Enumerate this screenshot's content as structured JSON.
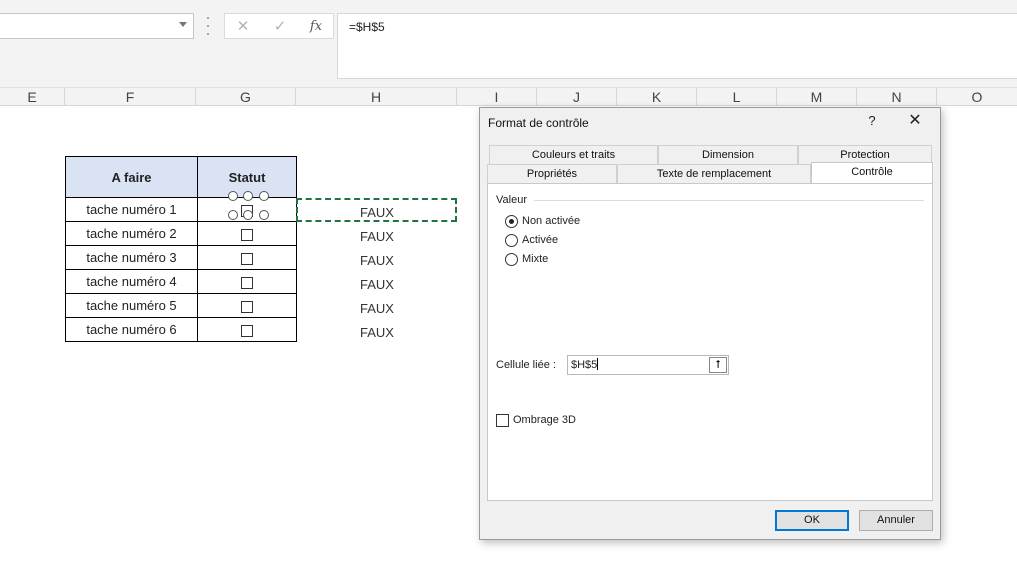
{
  "formula_bar": {
    "cancel_icon": "✕",
    "enter_icon": "✓",
    "fx_label": "fx",
    "formula": "=$H$5"
  },
  "columns": [
    "E",
    "F",
    "G",
    "H",
    "I",
    "J",
    "K",
    "L",
    "M",
    "N",
    "O"
  ],
  "task_table": {
    "headers": [
      "A faire",
      "Statut"
    ],
    "rows": [
      {
        "task": "tache numéro 1",
        "checked": false
      },
      {
        "task": "tache numéro 2",
        "checked": false
      },
      {
        "task": "tache numéro 3",
        "checked": false
      },
      {
        "task": "tache numéro 4",
        "checked": false
      },
      {
        "task": "tache numéro 5",
        "checked": false
      },
      {
        "task": "tache numéro 6",
        "checked": false
      }
    ]
  },
  "h_column_values": [
    "FAUX",
    "FAUX",
    "FAUX",
    "FAUX",
    "FAUX",
    "FAUX"
  ],
  "dialog": {
    "title": "Format de contrôle",
    "help": "?",
    "close": "✕",
    "tabs_back": [
      "Couleurs et traits",
      "Dimension",
      "Protection"
    ],
    "tabs_front": [
      "Propriétés",
      "Texte de remplacement",
      "Contrôle"
    ],
    "active_tab": "Contrôle",
    "group_label": "Valeur",
    "radios": [
      {
        "label": "Non activée",
        "selected": true
      },
      {
        "label": "Activée",
        "selected": false
      },
      {
        "label": "Mixte",
        "selected": false
      }
    ],
    "linked_cell_label": "Cellule liée :",
    "linked_cell_value": "$H$5",
    "range_button": "⭡",
    "shading_label": "Ombrage 3D",
    "shading_checked": false,
    "ok_label": "OK",
    "cancel_label": "Annuler"
  }
}
